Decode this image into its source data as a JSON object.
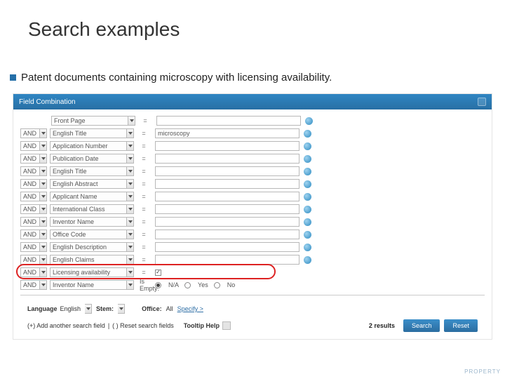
{
  "slide": {
    "title": "Search examples"
  },
  "bullet": {
    "text": "Patent documents containing microscopy with licensing availability."
  },
  "panel": {
    "title": "Field Combination"
  },
  "ops": [
    "AND",
    "AND",
    "AND",
    "AND",
    "AND",
    "AND",
    "AND",
    "AND",
    "AND",
    "AND",
    "AND",
    "AND",
    "AND"
  ],
  "rows": {
    "r0": {
      "field": "Front Page",
      "eq": "=",
      "value": ""
    },
    "r1": {
      "field": "English Title",
      "eq": "=",
      "value": "microscopy"
    },
    "r2": {
      "field": "Application Number",
      "eq": "=",
      "value": ""
    },
    "r3": {
      "field": "Publication Date",
      "eq": "=",
      "value": ""
    },
    "r4": {
      "field": "English Title",
      "eq": "=",
      "value": ""
    },
    "r5": {
      "field": "English Abstract",
      "eq": "=",
      "value": ""
    },
    "r6": {
      "field": "Applicant Name",
      "eq": "=",
      "value": ""
    },
    "r7": {
      "field": "International Class",
      "eq": "=",
      "value": ""
    },
    "r8": {
      "field": "Inventor Name",
      "eq": "=",
      "value": ""
    },
    "r9": {
      "field": "Office Code",
      "eq": "=",
      "value": ""
    },
    "r10": {
      "field": "English Description",
      "eq": "=",
      "value": ""
    },
    "r11": {
      "field": "English Claims",
      "eq": "=",
      "value": ""
    },
    "r12": {
      "field": "Licensing availability",
      "eq": "=",
      "checked": true
    },
    "r13": {
      "field": "Inventor Name",
      "opcol": "Is Empty:"
    }
  },
  "radios": {
    "na": "N/A",
    "yes": "Yes",
    "no": "No",
    "selected": "na"
  },
  "toolbar": {
    "language_label": "Language",
    "language_value": "English",
    "stem_label": "Stem:",
    "office_label": "Office:",
    "office_value": "All",
    "specify": "Specify >"
  },
  "footer": {
    "add": "(+) Add another search field",
    "sep": " | ",
    "reset_fields": "( ) Reset search fields",
    "tooltip_label": "Tooltip Help",
    "results_count": "2",
    "results_word": "results",
    "search_btn": "Search",
    "reset_btn": "Reset"
  },
  "watermark": "PROPERTY"
}
